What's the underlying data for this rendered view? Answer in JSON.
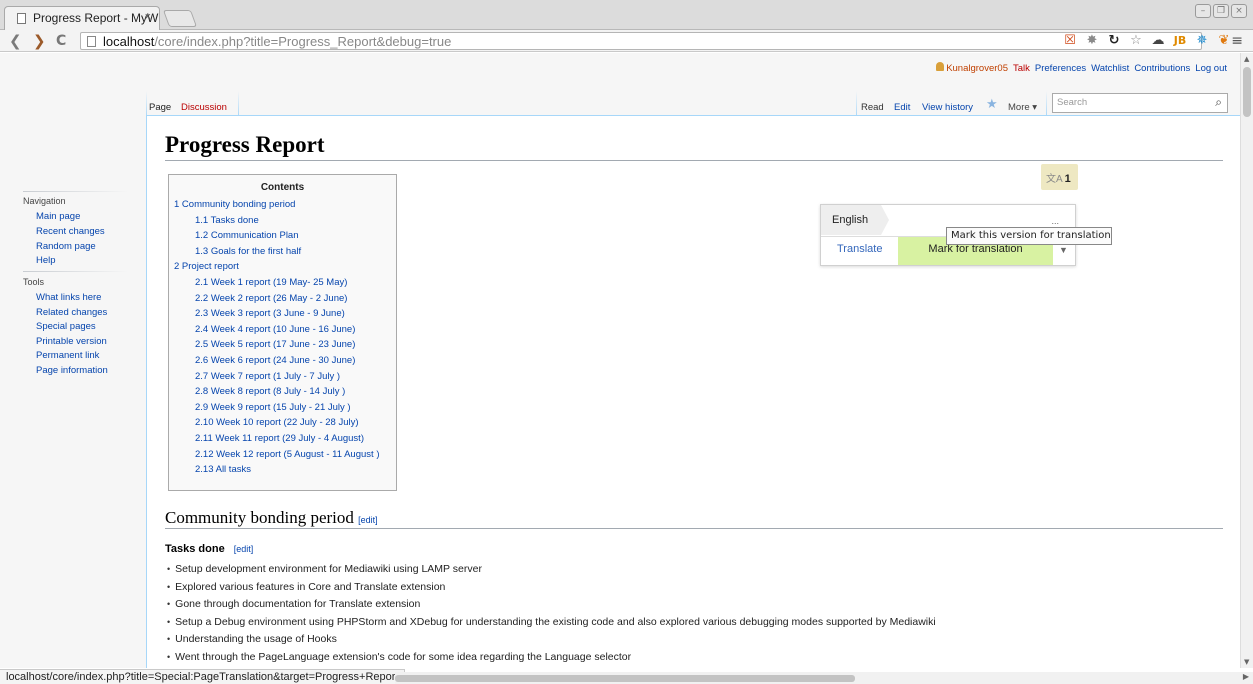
{
  "browser": {
    "tab_title": "Progress Report - MyW",
    "tab_close": "×",
    "url_host": "localhost",
    "url_path": "/core/index.php?title=Progress_Report&debug=true",
    "win_min": "–",
    "win_max": "❐",
    "win_close": "×",
    "back": "❮",
    "forward": "❯",
    "reload": "C",
    "menu": "≡",
    "ext_icons": [
      "rss-feed-icon",
      "settings-cog-icon",
      "sync-icon",
      "bookmark-star-icon",
      "cloud-icon",
      "jb-icon",
      "bug-icon",
      "veggie-icon"
    ]
  },
  "personal_tools": {
    "username": "Kunalgrover05",
    "talk": "Talk",
    "preferences": "Preferences",
    "watchlist": "Watchlist",
    "contributions": "Contributions",
    "logout": "Log out"
  },
  "tabs": {
    "page": "Page",
    "discussion": "Discussion",
    "read": "Read",
    "edit": "Edit",
    "view_history": "View history",
    "more": "More ▾",
    "search_placeholder": "Search"
  },
  "sidebar": {
    "navigation_heading": "Navigation",
    "navigation": [
      "Main page",
      "Recent changes",
      "Random page",
      "Help"
    ],
    "tools_heading": "Tools",
    "tools": [
      "What links here",
      "Related changes",
      "Special pages",
      "Printable version",
      "Permanent link",
      "Page information"
    ]
  },
  "page": {
    "title": "Progress Report"
  },
  "toc": {
    "title": "Contents",
    "items": [
      {
        "text": "1 Community bonding period",
        "level": 1
      },
      {
        "text": "1.1 Tasks done",
        "level": 2
      },
      {
        "text": "1.2 Communication Plan",
        "level": 2
      },
      {
        "text": "1.3 Goals for the first half",
        "level": 2
      },
      {
        "text": "2 Project report",
        "level": 1
      },
      {
        "text": "2.1 Week 1 report (19 May- 25 May)",
        "level": 2
      },
      {
        "text": "2.2 Week 2 report (26 May - 2 June)",
        "level": 2
      },
      {
        "text": "2.3 Week 3 report (3 June - 9 June)",
        "level": 2
      },
      {
        "text": "2.4 Week 4 report (10 June - 16 June)",
        "level": 2
      },
      {
        "text": "2.5 Week 5 report (17 June - 23 June)",
        "level": 2
      },
      {
        "text": "2.6 Week 6 report (24 June - 30 June)",
        "level": 2
      },
      {
        "text": "2.7 Week 7 report (1 July - 7 July )",
        "level": 2
      },
      {
        "text": "2.8 Week 8 report (8 July - 14 July )",
        "level": 2
      },
      {
        "text": "2.9 Week 9 report (15 July - 21 July )",
        "level": 2
      },
      {
        "text": "2.10 Week 10 report (22 July - 28 July)",
        "level": 2
      },
      {
        "text": "2.11 Week 11 report (29 July - 4 August)",
        "level": 2
      },
      {
        "text": "2.12 Week 12 report (5 August - 11 August )",
        "level": 2
      },
      {
        "text": "2.13 All tasks",
        "level": 2
      }
    ]
  },
  "translate_widget": {
    "glyph": "文A",
    "count": "1",
    "language": "English",
    "ellipsis": "...",
    "translate": "Translate",
    "mark": "Mark for translation",
    "dropdown": "▼",
    "tooltip": "Mark this version for translation"
  },
  "section1": {
    "heading": "Community bonding period",
    "edit": "[edit]"
  },
  "subsection1": {
    "heading": "Tasks done",
    "edit": "[edit]",
    "items": [
      "Setup development environment for Mediawiki using LAMP server",
      "Explored various features in Core and Translate extension",
      "Gone through documentation for Translate extension",
      "Setup a Debug environment using PHPStorm and XDebug for understanding the existing code and also explored various debugging modes supported by Mediawiki",
      "Understanding the usage of Hooks",
      "Went through the PageLanguage extension's code for some idea regarding the Language selector"
    ]
  },
  "status_bar": "localhost/core/index.php?title=Special:PageTranslation&target=Progress+Report"
}
